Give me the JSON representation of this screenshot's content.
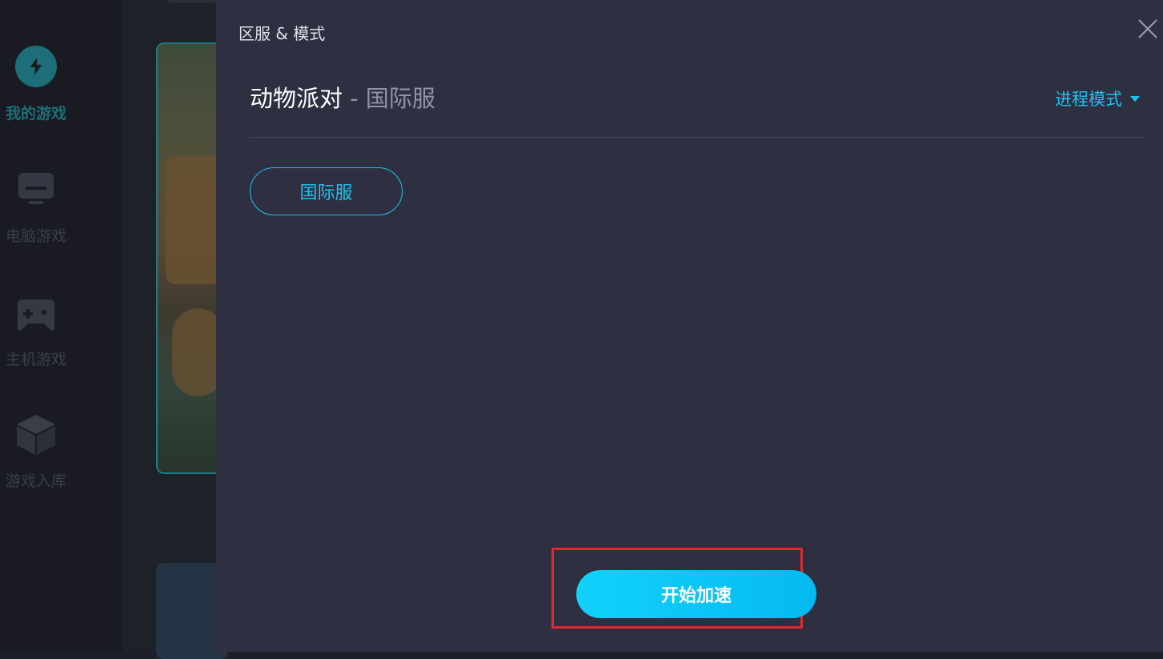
{
  "sidebar": {
    "items": [
      {
        "label": "我的游戏",
        "icon": "lightning-icon",
        "active": true
      },
      {
        "label": "电脑游戏",
        "icon": "monitor-icon",
        "active": false
      },
      {
        "label": "主机游戏",
        "icon": "gamepad-icon",
        "active": false
      },
      {
        "label": "游戏入库",
        "icon": "cube-icon",
        "active": false
      }
    ]
  },
  "dialog": {
    "title": "区服 & 模式",
    "game_name": "动物派对",
    "separator": "-",
    "selected_region": "国际服",
    "mode_label": "进程模式",
    "servers": [
      "国际服"
    ],
    "start_button": "开始加速"
  },
  "colors": {
    "accent": "#1cc2f0",
    "panel_bg": "#2e3042",
    "highlight": "#e3282c"
  }
}
